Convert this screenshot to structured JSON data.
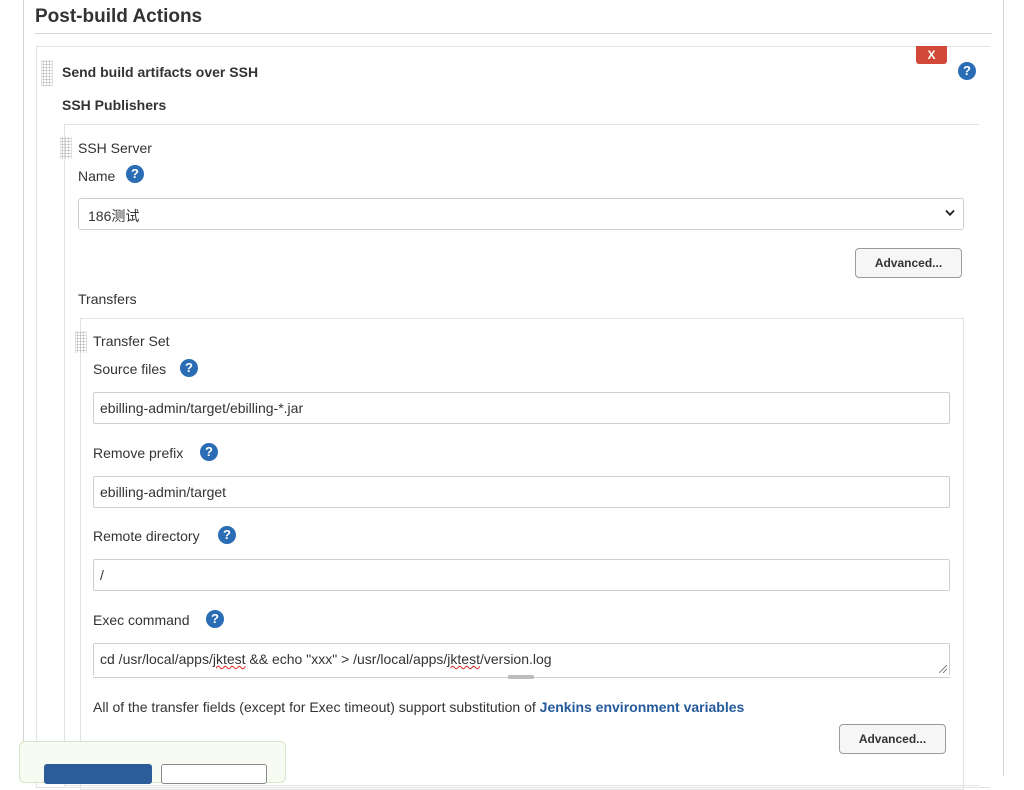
{
  "section": {
    "title": "Post-build Actions"
  },
  "publisher": {
    "title": "Send build artifacts over SSH",
    "delete_label": "X",
    "help_glyph": "?",
    "publishers_label": "SSH Publishers"
  },
  "server": {
    "title": "SSH Server",
    "name_label": "Name",
    "name_value": "186测试",
    "advanced_label": "Advanced...",
    "transfers_label": "Transfers"
  },
  "transfer": {
    "title": "Transfer Set",
    "source_label": "Source files",
    "source_value": "ebilling-admin/target/ebilling-*.jar",
    "remove_prefix_label": "Remove prefix",
    "remove_prefix_value": "ebilling-admin/target",
    "remote_dir_label": "Remote directory",
    "remote_dir_value": "/",
    "exec_label": "Exec command",
    "exec_value_parts": [
      "cd /usr/local/apps/",
      "jktest",
      " && echo \"xxx\" > /usr/local/apps/",
      "jktest",
      "/version.log"
    ],
    "note_text": "All of the transfer fields (except for Exec timeout) support substitution of ",
    "note_link": "Jenkins environment variables",
    "advanced_label": "Advanced..."
  },
  "icons": {
    "help": "help-icon",
    "select_arrow": "chevron-down-icon",
    "drag": "drag-handle-icon"
  },
  "colors": {
    "help": "#2a6db4",
    "delete": "#d24939",
    "link": "#245a9b",
    "save": "#2c5d98"
  }
}
